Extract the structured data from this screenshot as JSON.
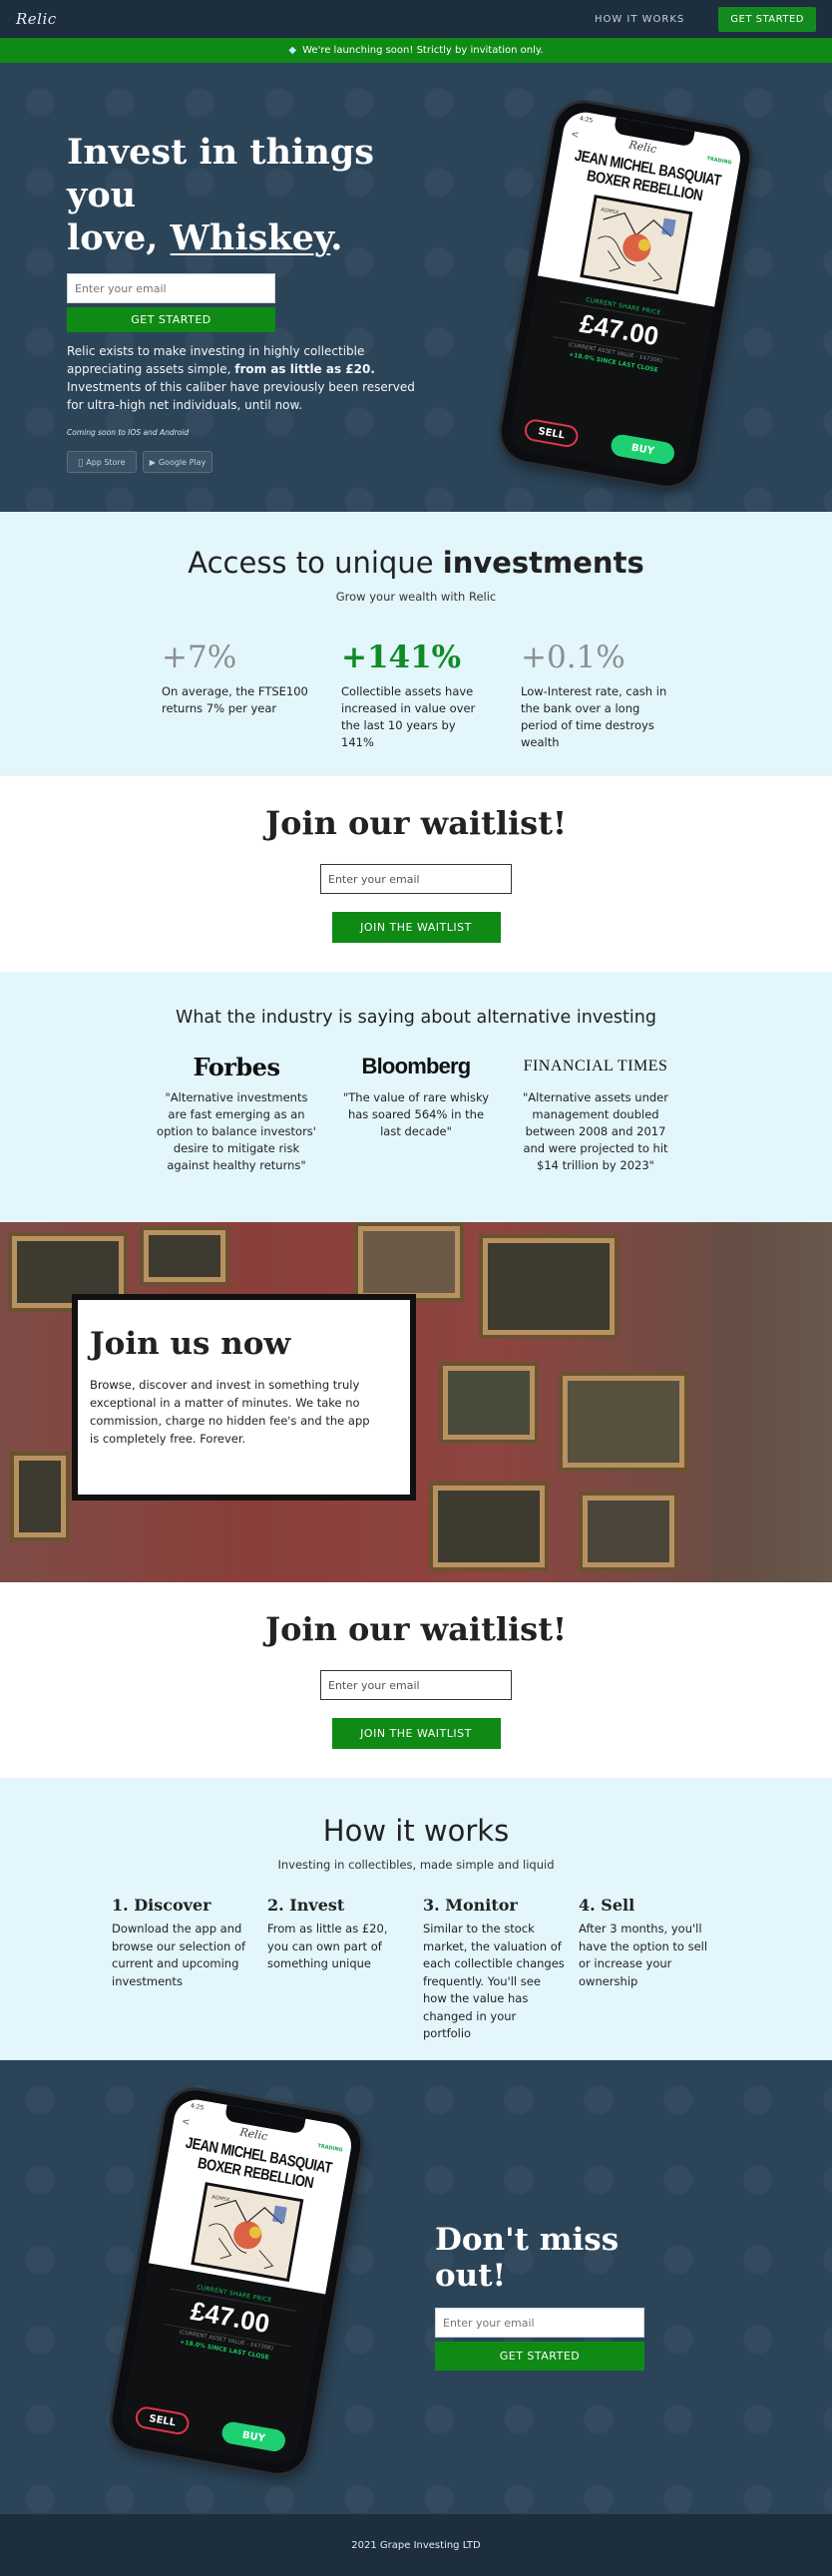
{
  "nav": {
    "logo": "Relic",
    "how_link": "HOW IT WORKS",
    "cta": "GET STARTED"
  },
  "announce": {
    "icon": "diamond-icon",
    "text": "We're launching soon! Strictly by invitation only."
  },
  "hero": {
    "title_line1": "Invest in things you",
    "title_line2_pre": "love, ",
    "title_highlight": "Whiskey",
    "title_suffix": ".",
    "email_placeholder": "Enter your email",
    "button": "GET STARTED",
    "desc_pre": "Relic exists to make investing in highly collectible appreciating assets simple, ",
    "desc_bold": "from as little as £20.",
    "desc_post": " Investments of this caliber have previously been reserved for ultra-high net individuals, until now.",
    "coming_soon": "Coming soon to IOS and Android",
    "store_apple": "App Store",
    "store_google": "Google Play"
  },
  "phone": {
    "time": "4:25",
    "logo": "Relic",
    "badge": "TRADING",
    "title_line1": "JEAN MICHEL BASQUIAT",
    "title_line2": "BOXER REBELLION",
    "share_label": "CURRENT SHARE PRICE",
    "price": "£47.00",
    "asset_value": "(CURRENT ASSET VALUE - £4730K)",
    "change": "+18.0% SINCE LAST CLOSE",
    "sell": "SELL",
    "buy": "BUY"
  },
  "access": {
    "title_pre": "Access to unique ",
    "title_bold": "investments",
    "subtitle": "Grow your wealth with Relic",
    "stats": [
      {
        "value": "+7%",
        "desc": "On average, the FTSE100 returns 7% per year"
      },
      {
        "value": "+141%",
        "desc": "Collectible assets have increased in value over the last 10 years by 141%"
      },
      {
        "value": "+0.1%",
        "desc": "Low-Interest rate, cash in the bank over a long period of time destroys wealth"
      }
    ]
  },
  "waitlist": {
    "title": "Join our waitlist!",
    "placeholder": "Enter your email",
    "button": "JOIN THE WAITLIST"
  },
  "industry": {
    "title": "What the industry is saying about alternative investing",
    "quotes": [
      {
        "brand": "Forbes",
        "text": "\"Alternative investments are fast emerging as an option to balance investors' desire to mitigate risk against healthy returns\""
      },
      {
        "brand": "Bloomberg",
        "text": "\"The value of rare whisky has soared 564% in the last decade\""
      },
      {
        "brand": "FINANCIAL TIMES",
        "text": "\"Alternative assets under management doubled between 2008 and 2017 and were projected to hit $14 trillion by 2023\""
      }
    ]
  },
  "join_now": {
    "title": "Join us now",
    "desc": "Browse, discover and invest in something truly exceptional in a matter of minutes. We take no commission, charge no hidden fee's and the app is completely free. Forever."
  },
  "how": {
    "title": "How it works",
    "subtitle": "Investing in collectibles, made simple and liquid",
    "steps": [
      {
        "title": "1. Discover",
        "desc": "Download the app and browse our selection of current and upcoming investments"
      },
      {
        "title": "2. Invest",
        "desc": "From as little as £20, you can own part of something unique"
      },
      {
        "title": "3. Monitor",
        "desc": "Similar to the stock market, the valuation of each collectible changes frequently. You'll see how the value has changed in your portfolio"
      },
      {
        "title": "4. Sell",
        "desc": "After 3 months, you'll have the option to sell or increase your ownership"
      }
    ]
  },
  "cta": {
    "title": "Don't miss out!",
    "placeholder": "Enter your email",
    "button": "GET STARTED"
  },
  "footer": {
    "text": "2021 Grape Investing LTD"
  },
  "colors": {
    "navy": "#1d2e3f",
    "hero_bg": "#2c4458",
    "green": "#0f8a15",
    "light_blue": "#e2f6fc"
  }
}
